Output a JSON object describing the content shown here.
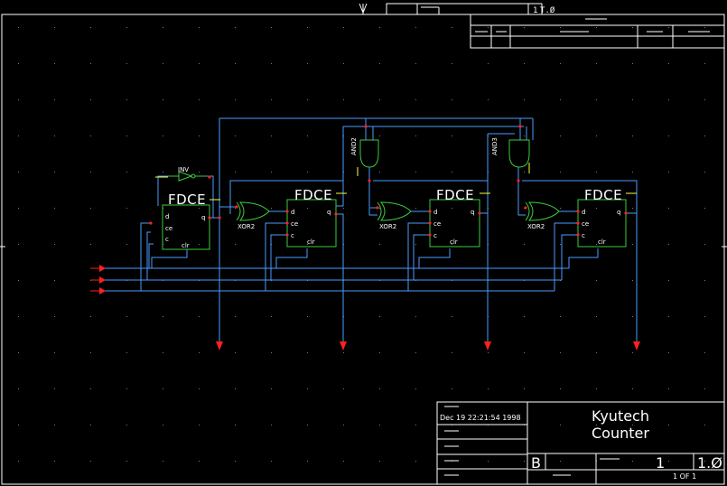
{
  "colors": {
    "background": "#000000",
    "border": "#ffffff",
    "wire": "#4a9cff",
    "component": "#3ccc3c",
    "pin_stub": "#ffff40",
    "io_marker": "#ff2020",
    "grid_dot": "#7a7a7a",
    "text": "#ffffff"
  },
  "cells": {
    "ff1": {
      "type": "FDCE",
      "pins": {
        "d": "d",
        "ce": "ce",
        "c": "c",
        "clr": "clr",
        "q": "q"
      }
    },
    "ff2": {
      "type": "FDCE",
      "pins": {
        "d": "d",
        "ce": "ce",
        "c": "c",
        "clr": "clr",
        "q": "q"
      }
    },
    "ff3": {
      "type": "FDCE",
      "pins": {
        "d": "d",
        "ce": "ce",
        "c": "c",
        "clr": "clr",
        "q": "q"
      }
    },
    "ff4": {
      "type": "FDCE",
      "pins": {
        "d": "d",
        "ce": "ce",
        "c": "c",
        "clr": "clr",
        "q": "q"
      }
    }
  },
  "gates": {
    "inv": "INV",
    "xor1": "XOR2",
    "xor2": "XOR2",
    "xor3": "XOR2",
    "and1": "AND2",
    "and2": "AND3"
  },
  "title_block": {
    "timestamp": "Dec 19 22:21:54 1998",
    "company": "Kyutech",
    "design": "Counter",
    "size": "B",
    "sheet_number": "1",
    "revision": "1.Ø",
    "sheet_of": "1 OF 1"
  },
  "top_block": {
    "rev_cell": "1",
    "rev_value": "T.Ø"
  }
}
